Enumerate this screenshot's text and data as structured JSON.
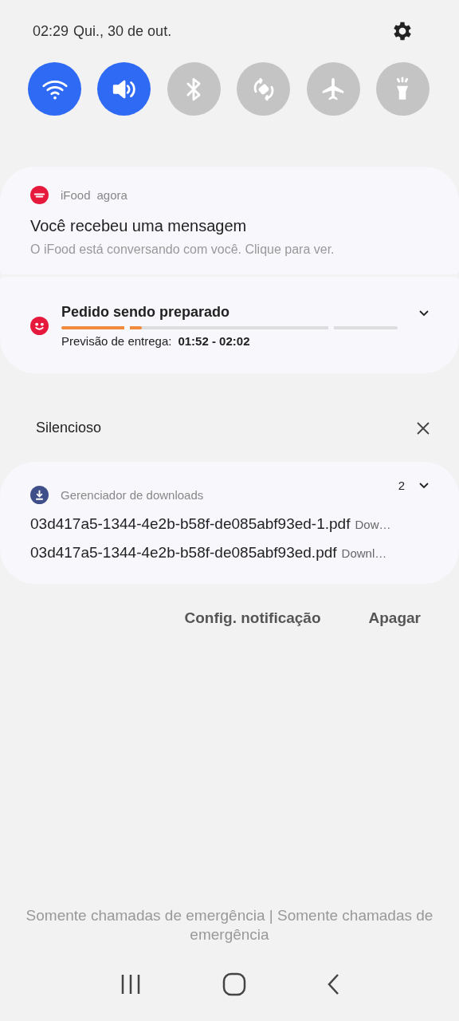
{
  "status": {
    "time": "02:29",
    "date": "Qui., 30 de out."
  },
  "quick_toggles": [
    {
      "kind": "wifi",
      "on": true
    },
    {
      "kind": "sound",
      "on": true
    },
    {
      "kind": "bluetooth",
      "on": false
    },
    {
      "kind": "rotate",
      "on": false
    },
    {
      "kind": "airplane",
      "on": false
    },
    {
      "kind": "flashlight",
      "on": false
    }
  ],
  "notifications": [
    {
      "app": "iFood",
      "time": "agora",
      "title": "Você recebeu uma mensagem",
      "text": "O iFood está conversando com você. Clique para ver."
    },
    {
      "title": "Pedido sendo preparado",
      "progress": {
        "level": 0.24
      },
      "eta_label": "Previsão de entrega:",
      "eta": "01:52 - 02:02"
    }
  ],
  "silent_section": {
    "title": "Silencioso"
  },
  "downloads": {
    "app": "Gerenciador de downloads",
    "count": "2",
    "files": [
      {
        "name": "03d417a5-1344-4e2b-b58f-de085abf93ed-1.pdf",
        "status": "Dow…"
      },
      {
        "name": "03d417a5-1344-4e2b-b58f-de085abf93ed.pdf",
        "status": "Downl…"
      }
    ]
  },
  "actions": [
    "Config. notificação",
    "Apagar"
  ],
  "footer": "Somente chamadas de emergência | Somente chamadas de emergência"
}
